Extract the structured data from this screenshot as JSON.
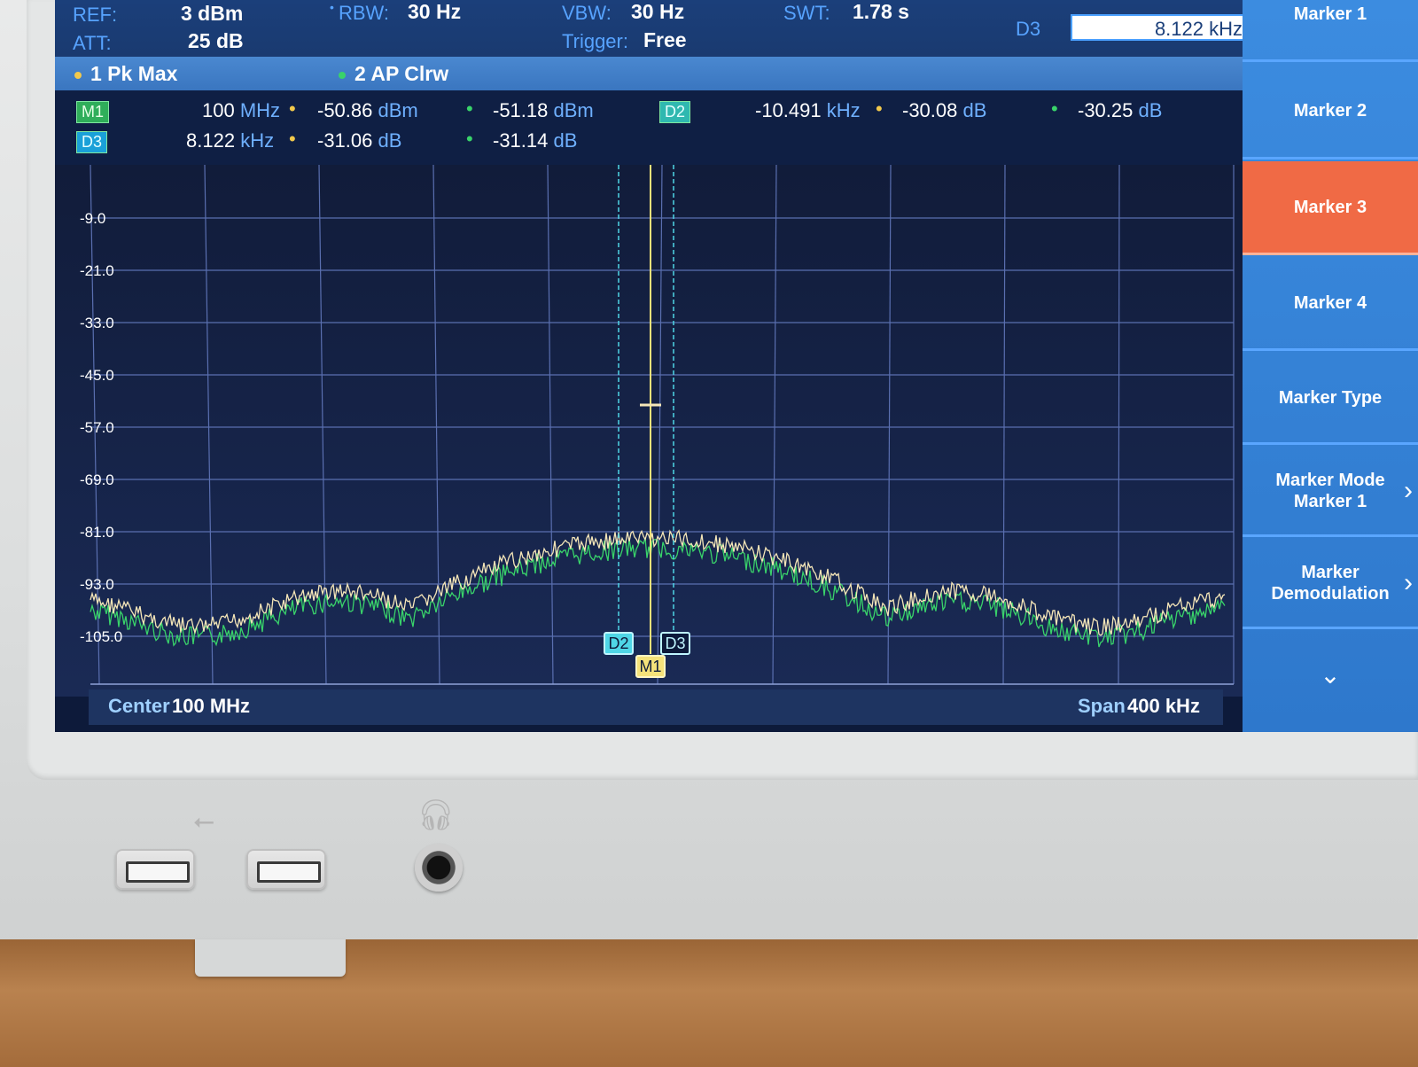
{
  "header": {
    "ref_label": "REF:",
    "ref_value": "3 dBm",
    "att_label": "ATT:",
    "att_value": "25 dB",
    "rbw_label": "RBW:",
    "rbw_value": "30 Hz",
    "vbw_label": "VBW:",
    "vbw_value": "30 Hz",
    "trigger_label": "Trigger:",
    "trigger_value": "Free",
    "swt_label": "SWT:",
    "swt_value": "1.78 s",
    "marker_entry_label": "D3",
    "marker_entry_value": "8.122 kHz"
  },
  "traces": {
    "trace1": "1 Pk Max",
    "trace2": "2 AP Clrw",
    "trace1_color": "#f2c94c",
    "trace2_color": "#39d36a"
  },
  "marker_table": {
    "m1": {
      "tag": "M1",
      "x": "100",
      "x_unit": "MHz",
      "y1": "-50.86",
      "y1_unit": "dBm",
      "y2": "-51.18",
      "y2_unit": "dBm"
    },
    "d2": {
      "tag": "D2",
      "x": "-10.491",
      "x_unit": "kHz",
      "y1": "-30.08",
      "y1_unit": "dB",
      "y2": "-30.25",
      "y2_unit": "dB"
    },
    "d3": {
      "tag": "D3",
      "x": "8.122",
      "x_unit": "kHz",
      "y1": "-31.06",
      "y1_unit": "dB",
      "y2": "-31.14",
      "y2_unit": "dB"
    }
  },
  "plot": {
    "y_ticks": [
      "-9.0",
      "-21.0",
      "-33.0",
      "-45.0",
      "-57.0",
      "-69.0",
      "-81.0",
      "-93.0",
      "-105.0"
    ],
    "center_label": "Center",
    "center_value": "100 MHz",
    "span_label": "Span",
    "span_value": "400 kHz",
    "marker_flags": [
      "D2",
      "D3",
      "M1"
    ]
  },
  "softkeys": [
    {
      "label": "Marker 1"
    },
    {
      "label": "Marker 2"
    },
    {
      "label": "Marker 3",
      "active": true
    },
    {
      "label": "Marker 4"
    },
    {
      "label": "Marker Type"
    },
    {
      "label": "Marker Mode\nMarker 1"
    },
    {
      "label": "Marker\nDemodulation"
    }
  ],
  "colors": {
    "accent_active": "#f06a45",
    "screen_bg": "#0d1a3a",
    "label_blue": "#57a3ff"
  }
}
